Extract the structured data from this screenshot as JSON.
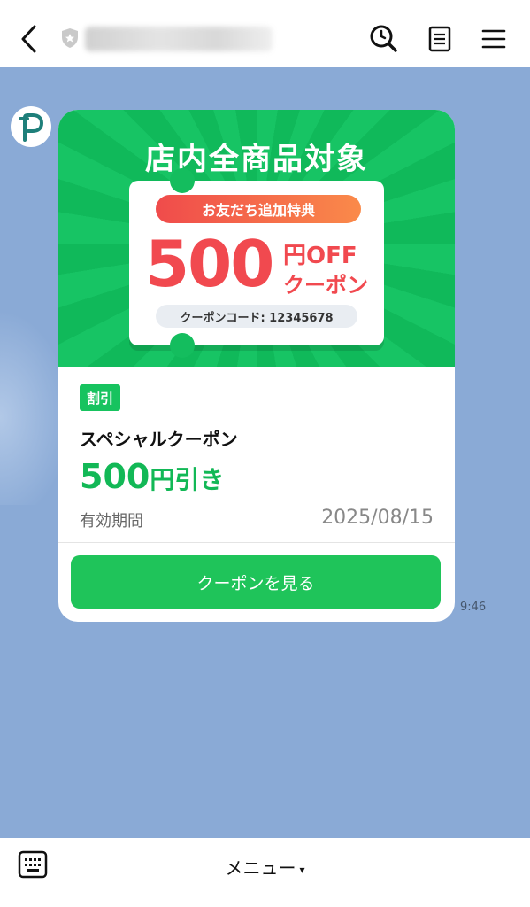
{
  "header": {
    "back_icon": "chevron-left-icon",
    "shield_icon": "shield-star-icon",
    "title_blurred": "",
    "search_icon": "search-history-icon",
    "notes_icon": "notes-icon",
    "menu_icon": "hamburger-menu-icon"
  },
  "avatar": {
    "letter": "P",
    "accent": "#1e7f7a"
  },
  "coupon_card": {
    "banner": {
      "headline": "店内全商品対象",
      "pill": "お友だち追加特典",
      "amount": "500",
      "off_line1": "円OFF",
      "off_line2": "クーポン",
      "code": "クーポンコード: 12345678"
    },
    "badge": "割引",
    "title": "スペシャルクーポン",
    "discount_num": "500",
    "discount_unit": "円引き",
    "period_label": "有効期間",
    "period_value": "2025/08/15",
    "cta": "クーポンを見る"
  },
  "timestamp": "9:46",
  "footer": {
    "keyboard_icon": "keyboard-icon",
    "menu_label": "メニュー",
    "caret": "▾"
  },
  "colors": {
    "chat_bg": "#8aaad6",
    "green": "#1fc45a",
    "red": "#f1494f"
  }
}
